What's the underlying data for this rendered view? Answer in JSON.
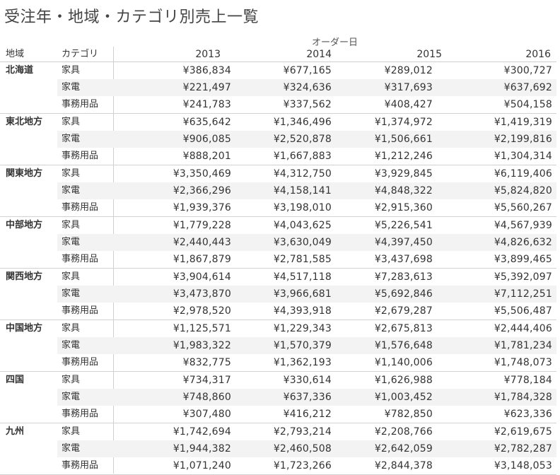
{
  "title": "受注年・地域・カテゴリ別売上一覧",
  "column_group_header": "オーダー日",
  "headers": {
    "region": "地域",
    "category": "カテゴリ",
    "years": [
      "2013",
      "2014",
      "2015",
      "2016"
    ]
  },
  "regions": [
    {
      "name": "北海道",
      "rows": [
        {
          "category": "家具",
          "values": [
            "¥386,834",
            "¥677,165",
            "¥289,012",
            "¥300,727"
          ]
        },
        {
          "category": "家電",
          "values": [
            "¥221,497",
            "¥324,636",
            "¥317,693",
            "¥637,692"
          ]
        },
        {
          "category": "事務用品",
          "values": [
            "¥241,783",
            "¥337,562",
            "¥408,427",
            "¥504,158"
          ]
        }
      ]
    },
    {
      "name": "東北地方",
      "rows": [
        {
          "category": "家具",
          "values": [
            "¥635,642",
            "¥1,346,496",
            "¥1,374,972",
            "¥1,419,319"
          ]
        },
        {
          "category": "家電",
          "values": [
            "¥906,085",
            "¥2,520,878",
            "¥1,506,661",
            "¥2,199,816"
          ]
        },
        {
          "category": "事務用品",
          "values": [
            "¥888,201",
            "¥1,667,883",
            "¥1,212,246",
            "¥1,304,314"
          ]
        }
      ]
    },
    {
      "name": "関東地方",
      "rows": [
        {
          "category": "家具",
          "values": [
            "¥3,350,469",
            "¥4,312,750",
            "¥3,929,845",
            "¥6,119,406"
          ]
        },
        {
          "category": "家電",
          "values": [
            "¥2,366,296",
            "¥4,158,141",
            "¥4,848,322",
            "¥5,824,820"
          ]
        },
        {
          "category": "事務用品",
          "values": [
            "¥1,939,376",
            "¥3,198,010",
            "¥2,915,360",
            "¥5,560,267"
          ]
        }
      ]
    },
    {
      "name": "中部地方",
      "rows": [
        {
          "category": "家具",
          "values": [
            "¥1,779,228",
            "¥4,043,625",
            "¥5,226,541",
            "¥4,567,939"
          ]
        },
        {
          "category": "家電",
          "values": [
            "¥2,440,443",
            "¥3,630,049",
            "¥4,397,450",
            "¥4,826,632"
          ]
        },
        {
          "category": "事務用品",
          "values": [
            "¥1,867,879",
            "¥2,781,585",
            "¥3,437,698",
            "¥3,899,465"
          ]
        }
      ]
    },
    {
      "name": "関西地方",
      "rows": [
        {
          "category": "家具",
          "values": [
            "¥3,904,614",
            "¥4,517,118",
            "¥7,283,613",
            "¥5,392,097"
          ]
        },
        {
          "category": "家電",
          "values": [
            "¥3,473,870",
            "¥3,966,681",
            "¥5,692,846",
            "¥7,112,251"
          ]
        },
        {
          "category": "事務用品",
          "values": [
            "¥2,978,520",
            "¥4,393,918",
            "¥2,679,287",
            "¥5,506,487"
          ]
        }
      ]
    },
    {
      "name": "中国地方",
      "rows": [
        {
          "category": "家具",
          "values": [
            "¥1,125,571",
            "¥1,229,343",
            "¥2,675,813",
            "¥2,444,406"
          ]
        },
        {
          "category": "家電",
          "values": [
            "¥1,983,322",
            "¥1,570,379",
            "¥1,576,648",
            "¥1,781,234"
          ]
        },
        {
          "category": "事務用品",
          "values": [
            "¥832,775",
            "¥1,362,193",
            "¥1,140,006",
            "¥1,748,073"
          ]
        }
      ]
    },
    {
      "name": "四国",
      "rows": [
        {
          "category": "家具",
          "values": [
            "¥734,317",
            "¥330,614",
            "¥1,626,988",
            "¥778,184"
          ]
        },
        {
          "category": "家電",
          "values": [
            "¥748,860",
            "¥637,336",
            "¥1,003,452",
            "¥1,784,328"
          ]
        },
        {
          "category": "事務用品",
          "values": [
            "¥307,480",
            "¥416,212",
            "¥782,850",
            "¥623,336"
          ]
        }
      ]
    },
    {
      "name": "九州",
      "rows": [
        {
          "category": "家具",
          "values": [
            "¥1,742,694",
            "¥2,793,214",
            "¥2,208,766",
            "¥2,619,675"
          ]
        },
        {
          "category": "家電",
          "values": [
            "¥1,944,382",
            "¥2,460,508",
            "¥2,642,059",
            "¥2,782,287"
          ]
        },
        {
          "category": "事務用品",
          "values": [
            "¥1,071,240",
            "¥1,723,266",
            "¥2,844,378",
            "¥3,148,053"
          ]
        }
      ]
    }
  ]
}
